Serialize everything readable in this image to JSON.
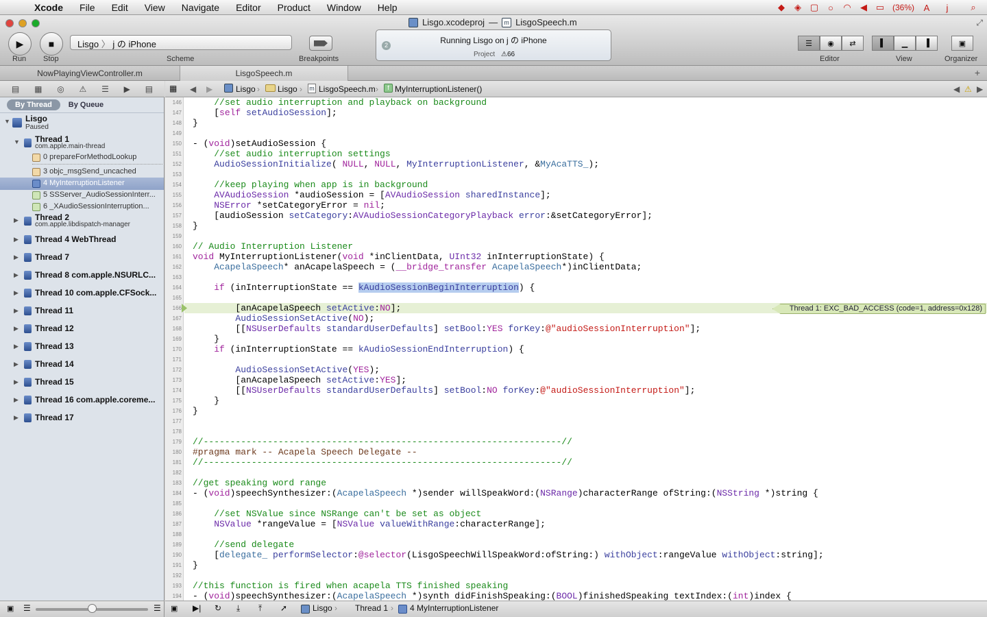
{
  "menubar": {
    "app": "Xcode",
    "items": [
      "File",
      "Edit",
      "View",
      "Navigate",
      "Editor",
      "Product",
      "Window",
      "Help"
    ],
    "battery": "(36%)",
    "user": "j"
  },
  "window": {
    "project": "Lisgo.xcodeproj",
    "separator": "—",
    "file": "LisgoSpeech.m"
  },
  "toolbar": {
    "run": "Run",
    "stop": "Stop",
    "scheme_app": "Lisgo",
    "scheme_chevron": "〉",
    "scheme_device": "j の iPhone",
    "scheme_label": "Scheme",
    "breakpoints": "Breakpoints",
    "activity_text": "Running Lisgo on j の iPhone",
    "activity_badge": "2",
    "activity_sub": "Project",
    "activity_warnings": "⚠66",
    "editor": "Editor",
    "view": "View",
    "organizer": "Organizer"
  },
  "tabs": [
    "NowPlayingViewController.m",
    "LisgoSpeech.m"
  ],
  "navigator": {
    "by_thread": "By Thread",
    "by_queue": "By Queue",
    "process": "Lisgo",
    "process_status": "Paused",
    "thread1": "Thread 1",
    "thread1_sub": "com.apple.main-thread",
    "frames": [
      "0 prepareForMethodLookup",
      "3 objc_msgSend_uncached",
      "4 MyInterruptionListener",
      "5 SSServer_AudioSessionInterr...",
      "6 _XAudioSessionInterruption..."
    ],
    "thread2": "Thread 2",
    "thread2_sub": "com.apple.libdispatch-manager",
    "threads": [
      "Thread 4 WebThread",
      "Thread 7",
      "Thread 8 com.apple.NSURLC...",
      "Thread 10 com.apple.CFSock...",
      "Thread 11",
      "Thread 12",
      "Thread 13",
      "Thread 14",
      "Thread 15",
      "Thread 16 com.apple.coreme...",
      "Thread 17"
    ]
  },
  "jumpbar": [
    "Lisgo",
    "Lisgo",
    "LisgoSpeech.m",
    "MyInterruptionListener()"
  ],
  "editor": {
    "line_numbers": [
      "146",
      "147",
      "148",
      "149",
      "150",
      "151",
      "152",
      "153",
      "154",
      "155",
      "156",
      "157",
      "158",
      "159",
      "160",
      "161",
      "162",
      "163",
      "164",
      "165",
      "166",
      "167",
      "168",
      "169",
      "170",
      "171",
      "172",
      "173",
      "174",
      "175",
      "176",
      "177",
      "178",
      "179",
      "180",
      "181",
      "182",
      "183",
      "184",
      "185",
      "186",
      "187",
      "188",
      "189",
      "190",
      "191",
      "192",
      "193",
      "194"
    ],
    "error": "Thread 1: EXC_BAD_ACCESS (code=1, address=0x128)"
  },
  "debugbar": [
    "Lisgo",
    "Thread 1",
    "4 MyInterruptionListener"
  ],
  "colors": {
    "selection": "#8fa3c9",
    "comment": "#1a8a1a",
    "keyword": "#a0249c",
    "string": "#c41a16",
    "error_line": "#e6f0d5"
  }
}
